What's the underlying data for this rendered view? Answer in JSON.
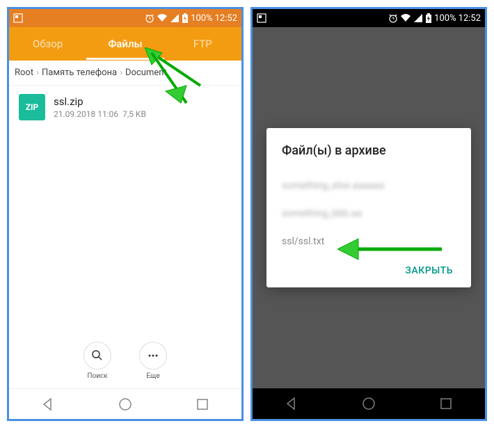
{
  "status": {
    "battery": "100%",
    "time": "12:52"
  },
  "phone1": {
    "tabs": {
      "overview": "Обзор",
      "files": "Файлы",
      "ftp": "FTP"
    },
    "breadcrumb": {
      "root": "Root",
      "storage": "Память телефона",
      "folder": "Document"
    },
    "file": {
      "icon_label": "ZIP",
      "name": "ssl.zip",
      "date": "21.09.2018 11:06",
      "size": "7,5 KB"
    },
    "actions": {
      "search": "Поиск",
      "more": "Еще"
    }
  },
  "phone2": {
    "dialog": {
      "title": "Файл(ы) в архиве",
      "item1": "something_else.aaaaaa",
      "item2": "something_bbb.aa",
      "item3": "ssl/ssl.txt",
      "close": "ЗАКРЫТЬ"
    }
  }
}
